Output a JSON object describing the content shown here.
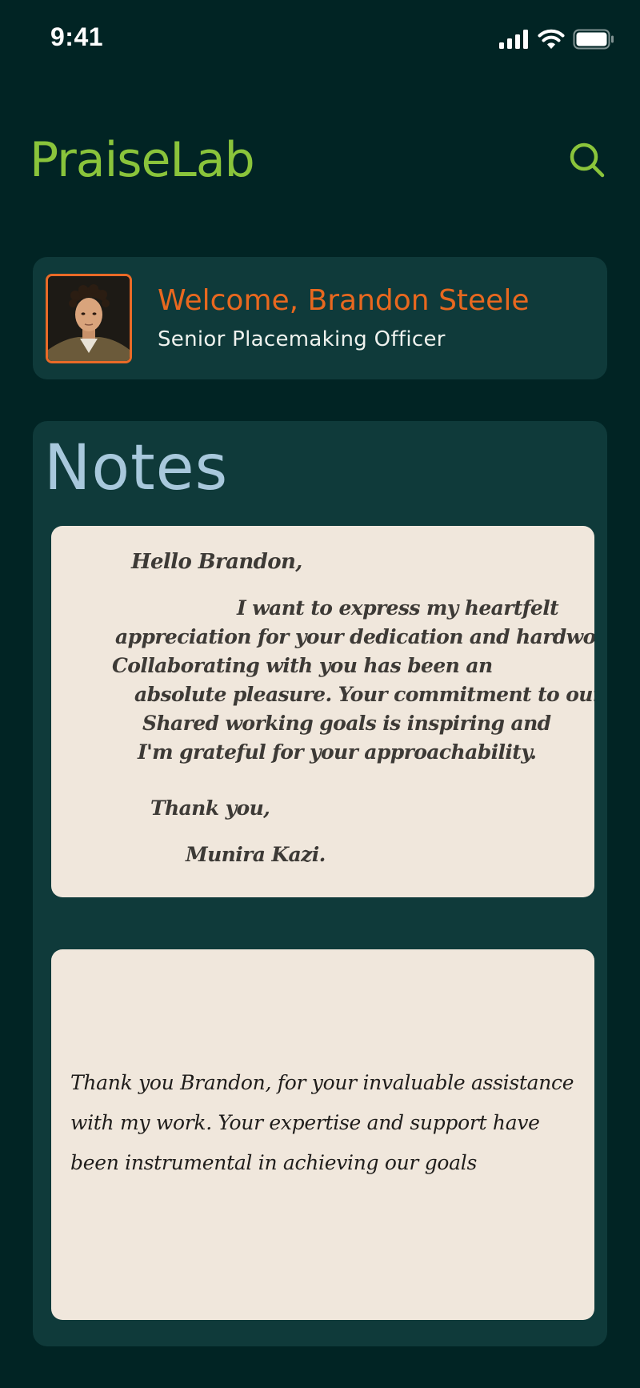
{
  "status_bar": {
    "time": "9:41",
    "icons": [
      "signal-icon",
      "wifi-icon",
      "battery-icon"
    ]
  },
  "header": {
    "app_title": "PraiseLab",
    "search_icon": "search-icon"
  },
  "profile": {
    "welcome": "Welcome, Brandon Steele",
    "role": "Senior Placemaking Officer",
    "avatar": "avatar"
  },
  "notes": {
    "heading": "Notes",
    "items": [
      {
        "lines": [
          "Hello Brandon,",
          "I want to express my heartfelt",
          "appreciation for your dedication and hardwork.",
          "Collaborating with you has been an",
          "absolute pleasure. Your commitment to our",
          "Shared working goals is inspiring and",
          "I'm grateful for your approachability.",
          "Thank you,",
          "Munira Kazi."
        ]
      },
      {
        "lines": [
          "Thank you Brandon, for your invaluable assistance",
          "with my work. Your expertise and support have",
          "been instrumental in achieving our goals"
        ]
      }
    ]
  },
  "colors": {
    "background": "#012424",
    "card": "#0f3a3a",
    "brand": "#8ac43b",
    "accent": "#e8681f",
    "heading": "#a8c8dc",
    "paper": "#f0e7dc"
  }
}
